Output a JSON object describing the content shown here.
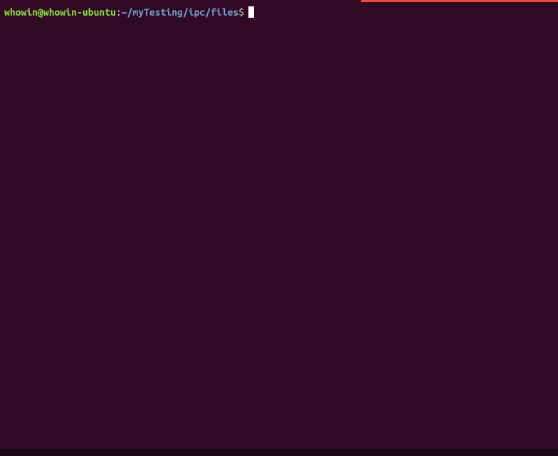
{
  "prompt": {
    "user_host": "whowin@whowin-ubuntu",
    "separator": ":",
    "path": "~/myTesting/ipc/files",
    "symbol": "$"
  },
  "command_input": ""
}
